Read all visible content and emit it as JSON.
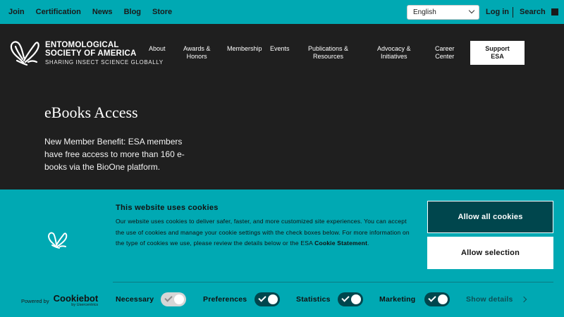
{
  "topbar": {
    "links": [
      "Join",
      "Certification",
      "News",
      "Blog",
      "Store"
    ],
    "language": "English",
    "login": "Log in",
    "search": "Search"
  },
  "header": {
    "logo_line1": "ENTOMOLOGICAL",
    "logo_line2": "SOCIETY OF AMERICA",
    "logo_tagline": "SHARING INSECT SCIENCE GLOBALLY",
    "nav": [
      {
        "l1": "About",
        "l2": ""
      },
      {
        "l1": "Awards &",
        "l2": "Honors"
      },
      {
        "l1": "Membership",
        "l2": ""
      },
      {
        "l1": "Events",
        "l2": ""
      },
      {
        "l1": "Publications &",
        "l2": "Resources"
      },
      {
        "l1": "Advocacy &",
        "l2": "Initiatives"
      },
      {
        "l1": "Career",
        "l2": "Center"
      }
    ],
    "support_l1": "Support",
    "support_l2": "ESA"
  },
  "hero": {
    "title": "eBooks Access",
    "text": "New Member Benefit: ESA members have free access to more than 160 e-books via the BioOne platform."
  },
  "cookie": {
    "title": "This website uses cookies",
    "body_part1": "Our website uses cookies to deliver safer, faster, and more customized site experiences. You can accept the use of cookies and manage your cookie settings with the check boxes below. For more information on the type of cookies we use, please review the details below or the ESA ",
    "body_link": "Cookie Statement",
    "body_part2": ".",
    "allow_all": "Allow all cookies",
    "allow_selection": "Allow selection",
    "powered_by": "Powered by",
    "brand": "Cookiebot",
    "brand_sub": "by Usercentrics",
    "toggles": [
      {
        "label": "Necessary",
        "state": "on-disabled"
      },
      {
        "label": "Preferences",
        "state": "on"
      },
      {
        "label": "Statistics",
        "state": "on"
      },
      {
        "label": "Marketing",
        "state": "on"
      }
    ],
    "show_details": "Show details"
  },
  "colors": {
    "teal": "#00a9b3",
    "dark": "#1f1f1f",
    "dark_teal": "#00464d"
  }
}
